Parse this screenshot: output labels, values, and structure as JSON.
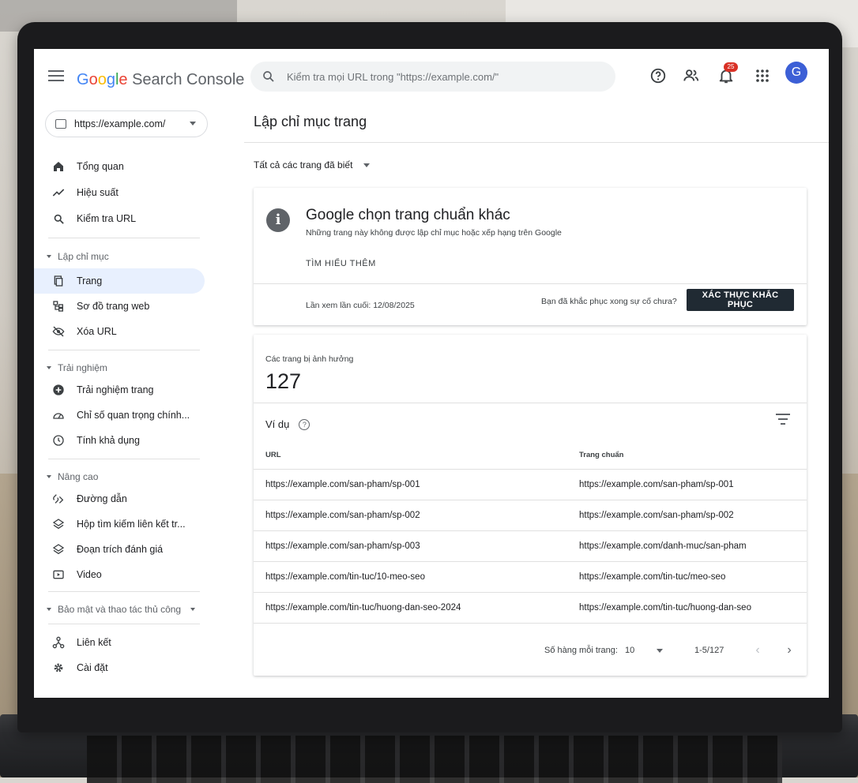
{
  "app": {
    "logo_google": [
      "G",
      "o",
      "o",
      "g",
      "l",
      "e"
    ],
    "logo_product": "Search Console"
  },
  "search": {
    "placeholder": "Kiểm tra mọi URL trong \"https://example.com/\""
  },
  "header": {
    "notifications_count": "25",
    "avatar_initial": "G"
  },
  "property": {
    "label": "https://example.com/"
  },
  "sidebar": {
    "top_items": [
      {
        "label": "Tổng quan",
        "icon": "home-icon"
      },
      {
        "label": "Hiệu suất",
        "icon": "trending-icon"
      },
      {
        "label": "Kiểm tra URL",
        "icon": "search-icon"
      }
    ],
    "sections": [
      {
        "title": "Lập chỉ mục",
        "items": [
          {
            "label": "Trang",
            "icon": "pages-icon",
            "active": true
          },
          {
            "label": "Sơ đồ trang web",
            "icon": "sitemap-icon"
          },
          {
            "label": "Xóa URL",
            "icon": "visibility-off-icon"
          }
        ]
      },
      {
        "title": "Trải nghiệm",
        "items": [
          {
            "label": "Trải nghiệm trang",
            "icon": "add-circle-icon"
          },
          {
            "label": "Chỉ số quan trọng chính...",
            "icon": "speed-icon"
          },
          {
            "label": "Tính khả dụng",
            "icon": "clock-icon"
          }
        ]
      },
      {
        "title": "Nâng cao",
        "items": [
          {
            "label": "Đường dẫn",
            "icon": "breadcrumb-icon"
          },
          {
            "label": "Hộp tìm kiếm liên kết tr...",
            "icon": "layers-icon"
          },
          {
            "label": "Đoạn trích đánh giá",
            "icon": "layers-icon"
          },
          {
            "label": "Video",
            "icon": "video-icon"
          }
        ]
      },
      {
        "title": "Bảo mật và thao tác thủ công",
        "items": []
      }
    ],
    "bottom_items": [
      {
        "label": "Liên kết",
        "icon": "links-icon"
      },
      {
        "label": "Cài đặt",
        "icon": "settings-icon"
      }
    ]
  },
  "main": {
    "page_title": "Lập chỉ mục trang",
    "filter_label": "Tất cả các trang đã biết",
    "issue_card": {
      "title": "Google chọn trang chuẩn khác",
      "subtitle": "Những trang này không được lập chỉ mục hoặc xếp hạng trên Google",
      "learn_more": "TÌM HIỂU THÊM",
      "last_crawled": "Lần xem lần cuối: 12/08/2025",
      "fixed_question": "Bạn đã khắc phục xong sự cố chưa?",
      "validate_button": "XÁC THỰC KHẮC PHỤC"
    },
    "affected_card": {
      "label": "Các trang bị ảnh hưởng",
      "count": "127",
      "examples_title": "Ví dụ",
      "columns": [
        "URL",
        "Trang chuẩn"
      ],
      "rows": [
        [
          "https://example.com/san-pham/sp-001",
          "https://example.com/san-pham/sp-001"
        ],
        [
          "https://example.com/san-pham/sp-002",
          "https://example.com/san-pham/sp-002"
        ],
        [
          "https://example.com/san-pham/sp-003",
          "https://example.com/danh-muc/san-pham"
        ],
        [
          "https://example.com/tin-tuc/10-meo-seo",
          "https://example.com/tin-tuc/meo-seo"
        ],
        [
          "https://example.com/tin-tuc/huong-dan-seo-2024",
          "https://example.com/tin-tuc/huong-dan-seo"
        ]
      ],
      "rows_per_page_label": "Số hàng mỗi trang:",
      "rows_per_page_value": "10",
      "range": "1-5/127"
    }
  },
  "colors": {
    "accent": "#1a73e8",
    "active_bg": "#e8f0fe",
    "button_dark": "#202a33",
    "badge": "#d93025"
  }
}
